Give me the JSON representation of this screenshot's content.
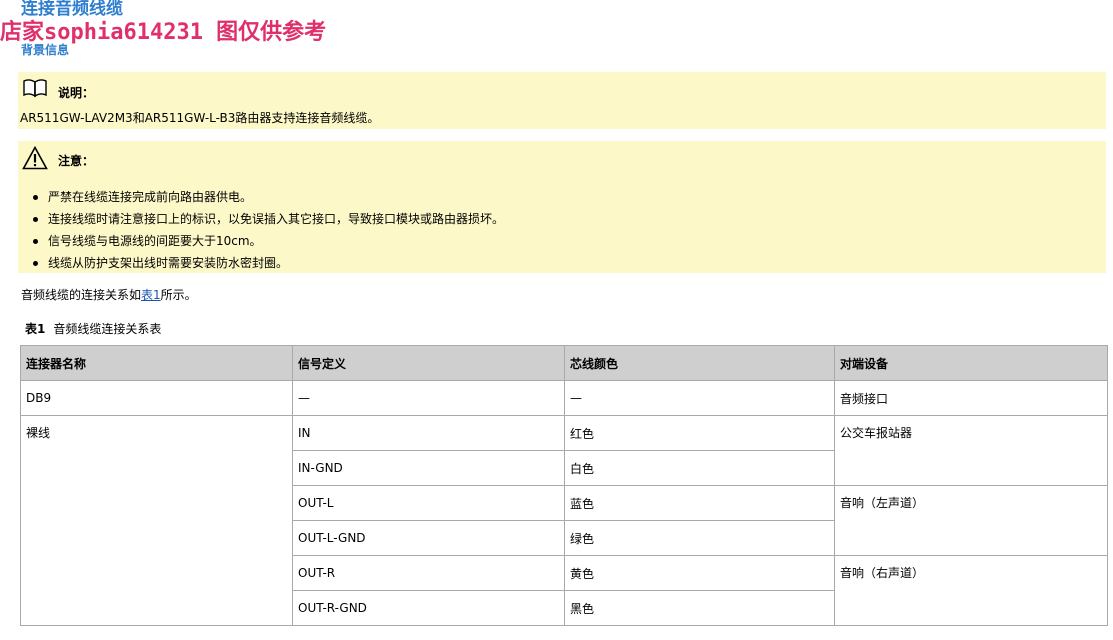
{
  "page_title": "连接音频线缆",
  "watermark": "店家sophia614231 图仅供参考",
  "section_heading": "背景信息",
  "info_note": {
    "icon": "book-icon",
    "label": "说明：",
    "text": "AR511GW-LAV2M3和AR511GW-L-B3路由器支持连接音频线缆。"
  },
  "caution_note": {
    "icon": "warning-triangle-icon",
    "label": "注意：",
    "items": [
      "严禁在线缆连接完成前向路由器供电。",
      "连接线缆时请注意接口上的标识，以免误插入其它接口，导致接口模块或路由器损坏。",
      "信号线缆与电源线的间距要大于10cm。",
      "线缆从防护支架出线时需要安装防水密封圈。"
    ]
  },
  "intro": {
    "before": "音频线缆的连接关系如",
    "link": "表1",
    "after": "所示。"
  },
  "table_caption": {
    "number": "表1",
    "title": "音频线缆连接关系表"
  },
  "table": {
    "headers": [
      "连接器名称",
      "信号定义",
      "芯线颜色",
      "对端设备"
    ],
    "rows": {
      "db9": {
        "connector": "DB9",
        "signal": "—",
        "color": "—",
        "peer": "音频接口"
      },
      "bare": {
        "connector": "裸线",
        "signals": [
          "IN",
          "IN-GND",
          "OUT-L",
          "OUT-L-GND",
          "OUT-R",
          "OUT-R-GND"
        ],
        "colors": [
          "红色",
          "白色",
          "蓝色",
          "绿色",
          "黄色",
          "黑色"
        ],
        "peers": [
          "公交车报站器",
          "音响（左声道）",
          "音响（右声道）"
        ]
      }
    }
  },
  "colors": {
    "heading_blue": "#2f7fd1",
    "watermark_pink": "#e0306a",
    "note_background": "#fcf8c8",
    "table_header_background": "#cfcfcf"
  }
}
